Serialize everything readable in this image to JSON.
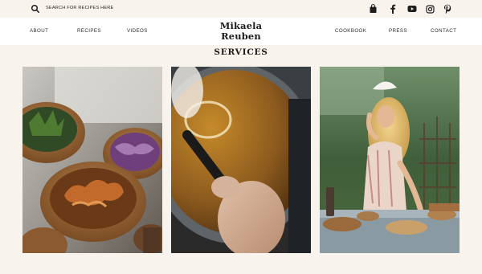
{
  "topbar": {
    "search_placeholder": "SEARCH FOR RECIPES HERE",
    "icons": [
      "search-icon",
      "shopping-bag-icon",
      "facebook-icon",
      "youtube-icon",
      "instagram-icon",
      "pinterest-icon"
    ]
  },
  "nav": {
    "left": [
      "ABOUT",
      "RECIPES",
      "VIDEOS"
    ],
    "right": [
      "COOKBOOK",
      "PRESS",
      "CONTACT"
    ]
  },
  "logo": {
    "line1": "Mikaela",
    "line2": "Reuben"
  },
  "section": {
    "title": "SERVICES"
  },
  "tiles": [
    {
      "name": "food-bowls-photo"
    },
    {
      "name": "cooking-pot-photo"
    },
    {
      "name": "garden-portrait-photo"
    }
  ],
  "colors": {
    "background": "#f8f3ec",
    "navbar": "#ffffff",
    "text": "#1e1e1e"
  }
}
